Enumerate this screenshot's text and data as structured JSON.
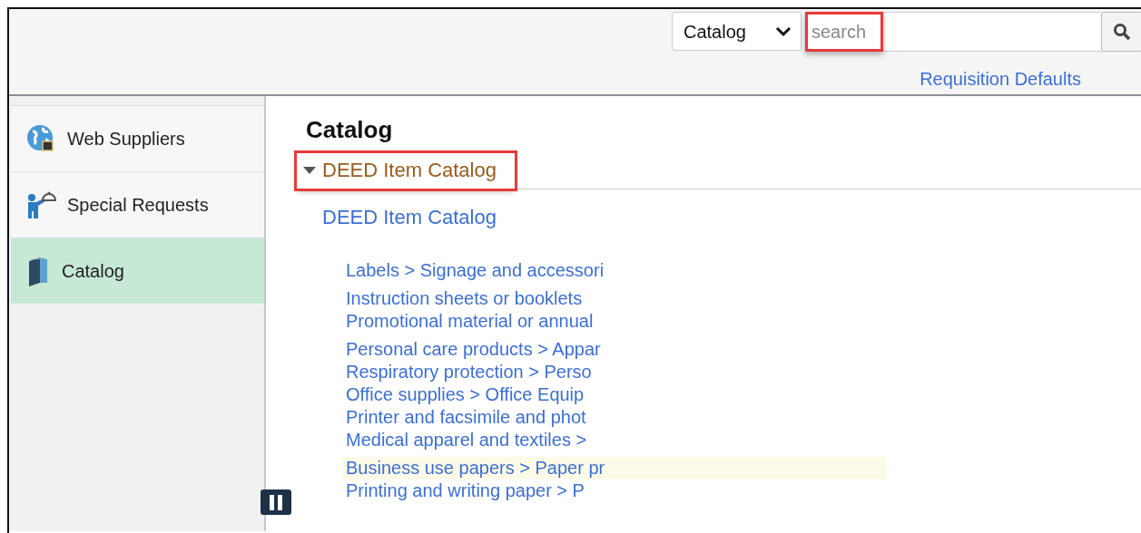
{
  "header": {
    "scope_select": {
      "value": "Catalog"
    },
    "search": {
      "placeholder": "search",
      "highlighted": true
    },
    "requisition_defaults": "Requisition Defaults"
  },
  "sidebar": {
    "items": [
      {
        "label": "Web Suppliers",
        "kind": "globe",
        "selected": false
      },
      {
        "label": "Special Requests",
        "kind": "person",
        "selected": false
      },
      {
        "label": "Catalog",
        "kind": "book",
        "selected": true
      }
    ]
  },
  "main": {
    "title": "Catalog",
    "section": {
      "label": "DEED Item Catalog",
      "expanded": true,
      "highlighted": true
    },
    "catalog_link": "DEED Item Catalog",
    "category_groups": [
      [
        {
          "label": "Labels > Signage and accessori",
          "highlighted": false
        }
      ],
      [
        {
          "label": "Instruction sheets or booklets",
          "highlighted": false
        },
        {
          "label": "Promotional material or annual",
          "highlighted": false
        }
      ],
      [
        {
          "label": "Personal care products > Appar",
          "highlighted": false
        },
        {
          "label": "Respiratory protection > Perso",
          "highlighted": false
        },
        {
          "label": "Office supplies > Office Equip",
          "highlighted": false
        },
        {
          "label": "Printer and facsimile and phot",
          "highlighted": false
        },
        {
          "label": "Medical apparel and textiles >",
          "highlighted": false
        }
      ],
      [
        {
          "label": "Business use papers > Paper pr",
          "highlighted": true
        },
        {
          "label": "Printing and writing paper > P",
          "highlighted": false
        }
      ]
    ]
  }
}
